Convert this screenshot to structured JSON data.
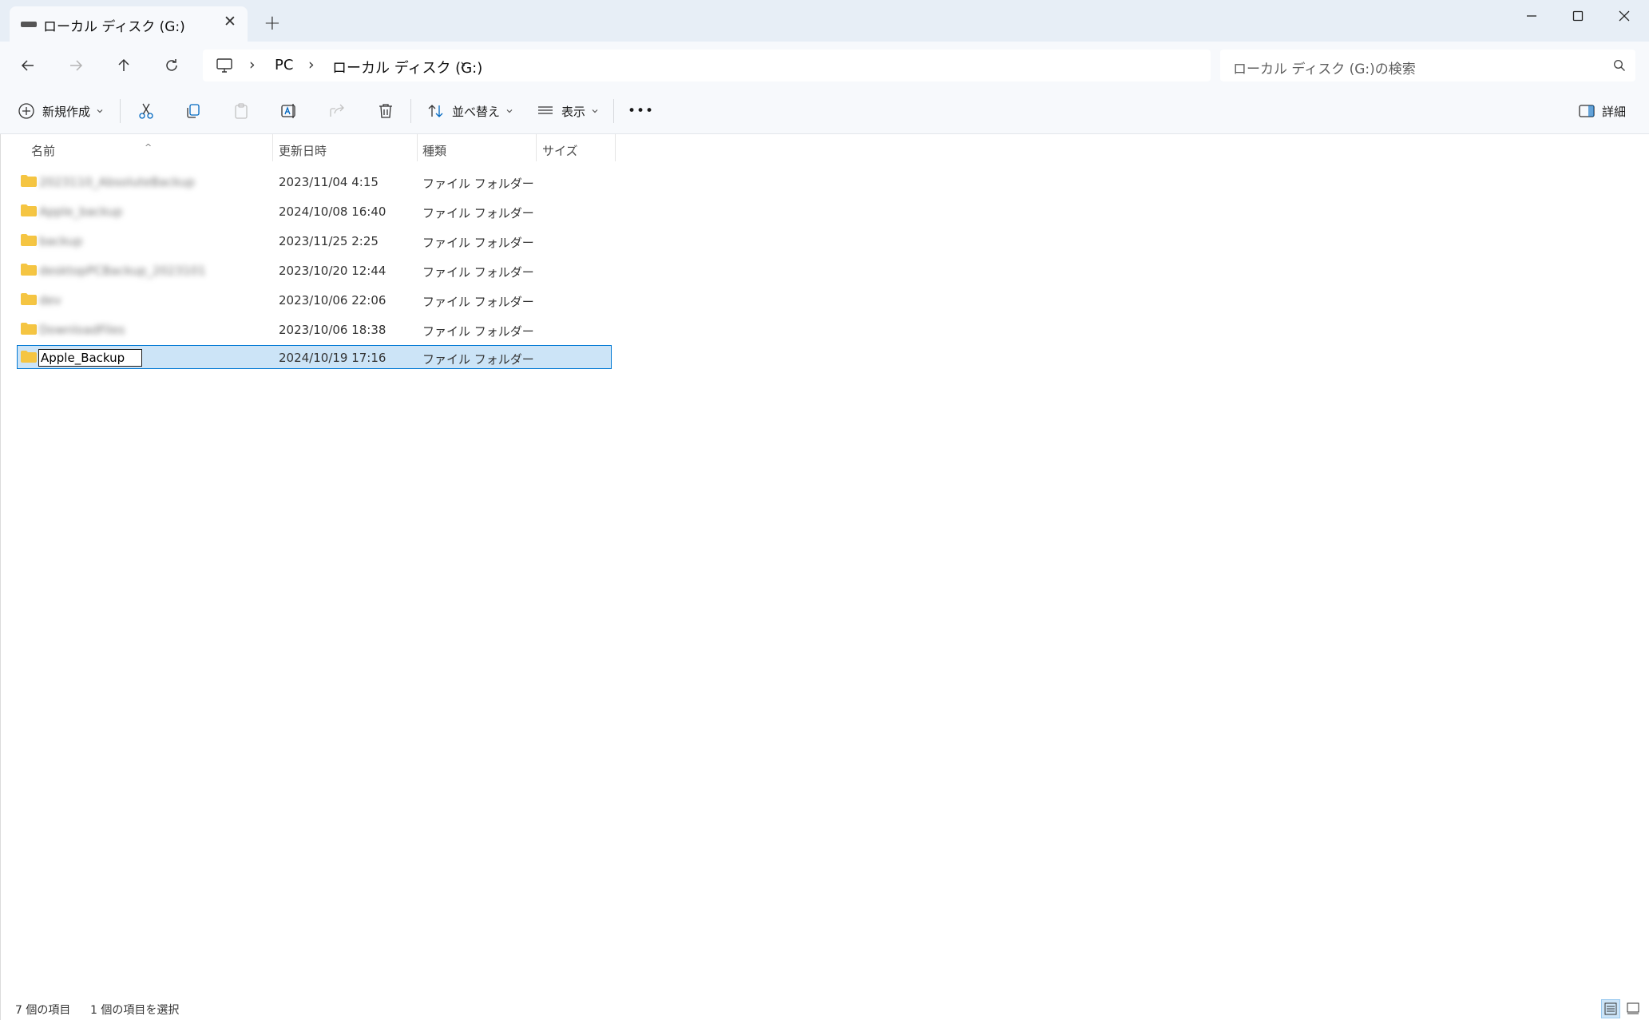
{
  "window": {
    "tab_title": "ローカル ディスク (G:)",
    "tab_close": "✕",
    "new_tab": "+"
  },
  "address": {
    "crumbs": [
      "PC",
      "ローカル ディスク (G:)"
    ],
    "search_placeholder": "ローカル ディスク (G:)の検索"
  },
  "toolbar": {
    "new_label": "新規作成",
    "sort_label": "並べ替え",
    "view_label": "表示",
    "more_label": "•••",
    "details_label": "詳細"
  },
  "columns": {
    "name": "名前",
    "modified": "更新日時",
    "type": "種類",
    "size": "サイズ"
  },
  "files": [
    {
      "name": "2023110_AbsoluteBackup",
      "modified": "2023/11/04 4:15",
      "type": "ファイル フォルダー"
    },
    {
      "name": "Apple_backup",
      "modified": "2024/10/08 16:40",
      "type": "ファイル フォルダー"
    },
    {
      "name": "backup",
      "modified": "2023/11/25 2:25",
      "type": "ファイル フォルダー"
    },
    {
      "name": "desktopPCBackup_2023101",
      "modified": "2023/10/20 12:44",
      "type": "ファイル フォルダー"
    },
    {
      "name": "dev",
      "modified": "2023/10/06 22:06",
      "type": "ファイル フォルダー"
    },
    {
      "name": "DownloadFiles",
      "modified": "2023/10/06 18:38",
      "type": "ファイル フォルダー"
    }
  ],
  "selected_row": {
    "rename_value": "Apple_Backup",
    "modified": "2024/10/19 17:16",
    "type": "ファイル フォルダー"
  },
  "status": {
    "item_count": "7 個の項目",
    "selected_count": "1 個の項目を選択"
  },
  "colors": {
    "selection_bg": "#cce4f7",
    "selection_border": "#0078d4",
    "folder_yellow": "#f5c542",
    "accent": "#0067c0"
  }
}
